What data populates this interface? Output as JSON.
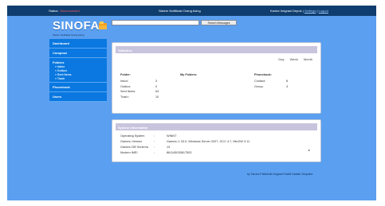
{
  "header": {
    "status_label": "Status:",
    "status_value": "Disconnected",
    "app_title": "Sistem Notifikasi Orang Asing",
    "office": "Kantor Imigrasi Depok",
    "separator": "|",
    "settings_link": "Settings",
    "logout_link": "Logout"
  },
  "logo": {
    "name": "SINOFA",
    "tagline": "Sistem Notifikasi Orang Asing",
    "icon": "folder-icon"
  },
  "search": {
    "placeholder": "",
    "button_label": "Search Messages"
  },
  "sidebar": {
    "dashboard": "Dashboard",
    "compose": "Compose",
    "folders": "Folders",
    "folder_items": [
      "Inbox",
      "Outbox",
      "Sent Items",
      "Trash"
    ],
    "phonebook": "Phonebook",
    "users": "Users"
  },
  "statistics": {
    "title": "Statistics",
    "periods": [
      "Day",
      "Week",
      "Month"
    ],
    "messages": {
      "heading": "Folder:",
      "rows": [
        {
          "label": "Inbox:",
          "value": "3"
        },
        {
          "label": "Outbox:",
          "value": "0"
        },
        {
          "label": "Sent Items:",
          "value": "63"
        },
        {
          "label": "Trash:",
          "value": "10"
        }
      ]
    },
    "my_folders": {
      "heading": "My Folders:"
    },
    "phonebook": {
      "heading": "Phonebook:",
      "rows": [
        {
          "label": "Contact:",
          "value": "8"
        },
        {
          "label": "Group:",
          "value": "3"
        }
      ]
    }
  },
  "system_info": {
    "title": "System Information",
    "colon": ":",
    "rows": [
      {
        "label": "Operating System",
        "value": "WINNT"
      },
      {
        "label": "Gammu Version",
        "value": "Gammu 1.33.0, Windows Server 2007, GCC 4.7, MinGW 3.11"
      },
      {
        "label": "Gammu DB Schema",
        "value": "13"
      },
      {
        "label": "Modem IMEI",
        "value": "861145035817503"
      }
    ],
    "arrow": "▸"
  },
  "footer": {
    "text": "by Taruna Politeknik Imigrasi Padhil Hadiah Zenpatra"
  }
}
